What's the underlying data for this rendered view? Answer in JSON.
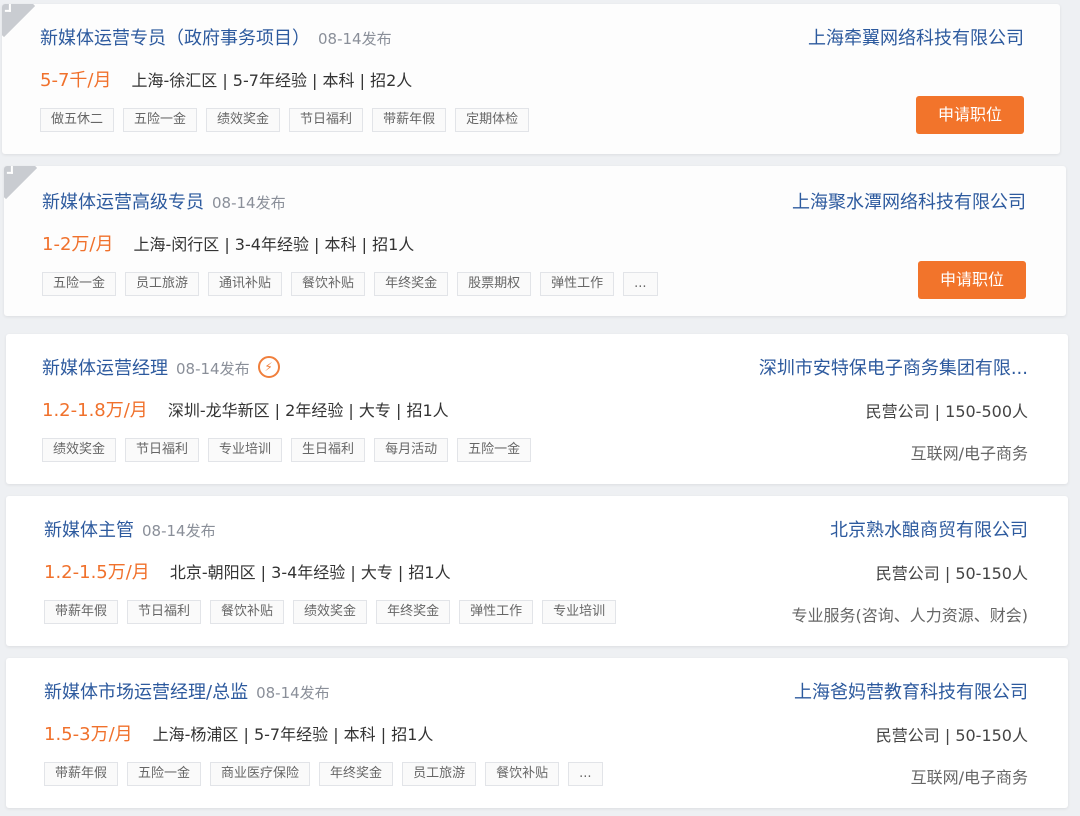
{
  "colors": {
    "accent": "#f2742b",
    "link": "#2d5a9e",
    "salary": "#f0712c"
  },
  "apply_label": "申请职位",
  "jobs": [
    {
      "title": "新媒体运营专员（政府事务项目）",
      "date": "08-14发布",
      "salary": "5-7千/月",
      "details": "上海-徐汇区 | 5-7年经验 | 本科 | 招2人",
      "tags": [
        "做五休二",
        "五险一金",
        "绩效奖金",
        "节日福利",
        "带薪年假",
        "定期体检"
      ],
      "company": "上海牵翼网络科技有限公司",
      "viewed": true
    },
    {
      "title": "新媒体运营高级专员",
      "date": "08-14发布",
      "salary": "1-2万/月",
      "details": "上海-闵行区 | 3-4年经验 | 本科 | 招1人",
      "tags": [
        "五险一金",
        "员工旅游",
        "通讯补贴",
        "餐饮补贴",
        "年终奖金",
        "股票期权",
        "弹性工作",
        "..."
      ],
      "company": "上海聚水潭网络科技有限公司",
      "viewed": true
    },
    {
      "title": "新媒体运营经理",
      "date": "08-14发布",
      "bolt": "⚡",
      "salary": "1.2-1.8万/月",
      "details": "深圳-龙华新区 | 2年经验 | 大专 | 招1人",
      "tags": [
        "绩效奖金",
        "节日福利",
        "专业培训",
        "生日福利",
        "每月活动",
        "五险一金"
      ],
      "company": "深圳市安特保电子商务集团有限...",
      "company_info": "民营公司 | 150-500人",
      "industry": "互联网/电子商务"
    },
    {
      "title": "新媒体主管",
      "date": "08-14发布",
      "salary": "1.2-1.5万/月",
      "details": "北京-朝阳区 | 3-4年经验 | 大专 | 招1人",
      "tags": [
        "带薪年假",
        "节日福利",
        "餐饮补贴",
        "绩效奖金",
        "年终奖金",
        "弹性工作",
        "专业培训"
      ],
      "company": "北京熟水酿商贸有限公司",
      "company_info": "民营公司 | 50-150人",
      "industry": "专业服务(咨询、人力资源、财会)"
    },
    {
      "title": "新媒体市场运营经理/总监",
      "date": "08-14发布",
      "salary": "1.5-3万/月",
      "details": "上海-杨浦区 | 5-7年经验 | 本科 | 招1人",
      "tags": [
        "带薪年假",
        "五险一金",
        "商业医疗保险",
        "年终奖金",
        "员工旅游",
        "餐饮补贴",
        "..."
      ],
      "company": "上海爸妈营教育科技有限公司",
      "company_info": "民营公司 | 50-150人",
      "industry": "互联网/电子商务"
    }
  ]
}
